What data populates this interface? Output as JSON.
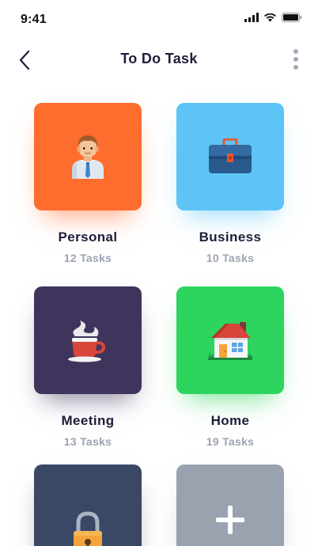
{
  "status_bar": {
    "time": "9:41",
    "icons": [
      "signal-icon",
      "wifi-icon",
      "battery-icon"
    ]
  },
  "nav": {
    "title": "To Do Task",
    "back_icon": "chevron-left-icon",
    "more_icon": "more-vertical-icon"
  },
  "categories": [
    {
      "title": "Personal",
      "count": "12 Tasks",
      "color": "#ff6d2e",
      "icon": "person-icon"
    },
    {
      "title": "Business",
      "count": "10 Tasks",
      "color": "#5ec3f5",
      "icon": "briefcase-icon"
    },
    {
      "title": "Meeting",
      "count": "13 Tasks",
      "color": "#3f345c",
      "icon": "coffee-cup-icon"
    },
    {
      "title": "Home",
      "count": "19 Tasks",
      "color": "#2dd45d",
      "icon": "house-icon"
    },
    {
      "title": "",
      "count": "",
      "color": "#3a4866",
      "icon": "padlock-icon"
    },
    {
      "title": "",
      "count": "",
      "color": "#9aa2b0",
      "icon": "plus-icon"
    }
  ]
}
